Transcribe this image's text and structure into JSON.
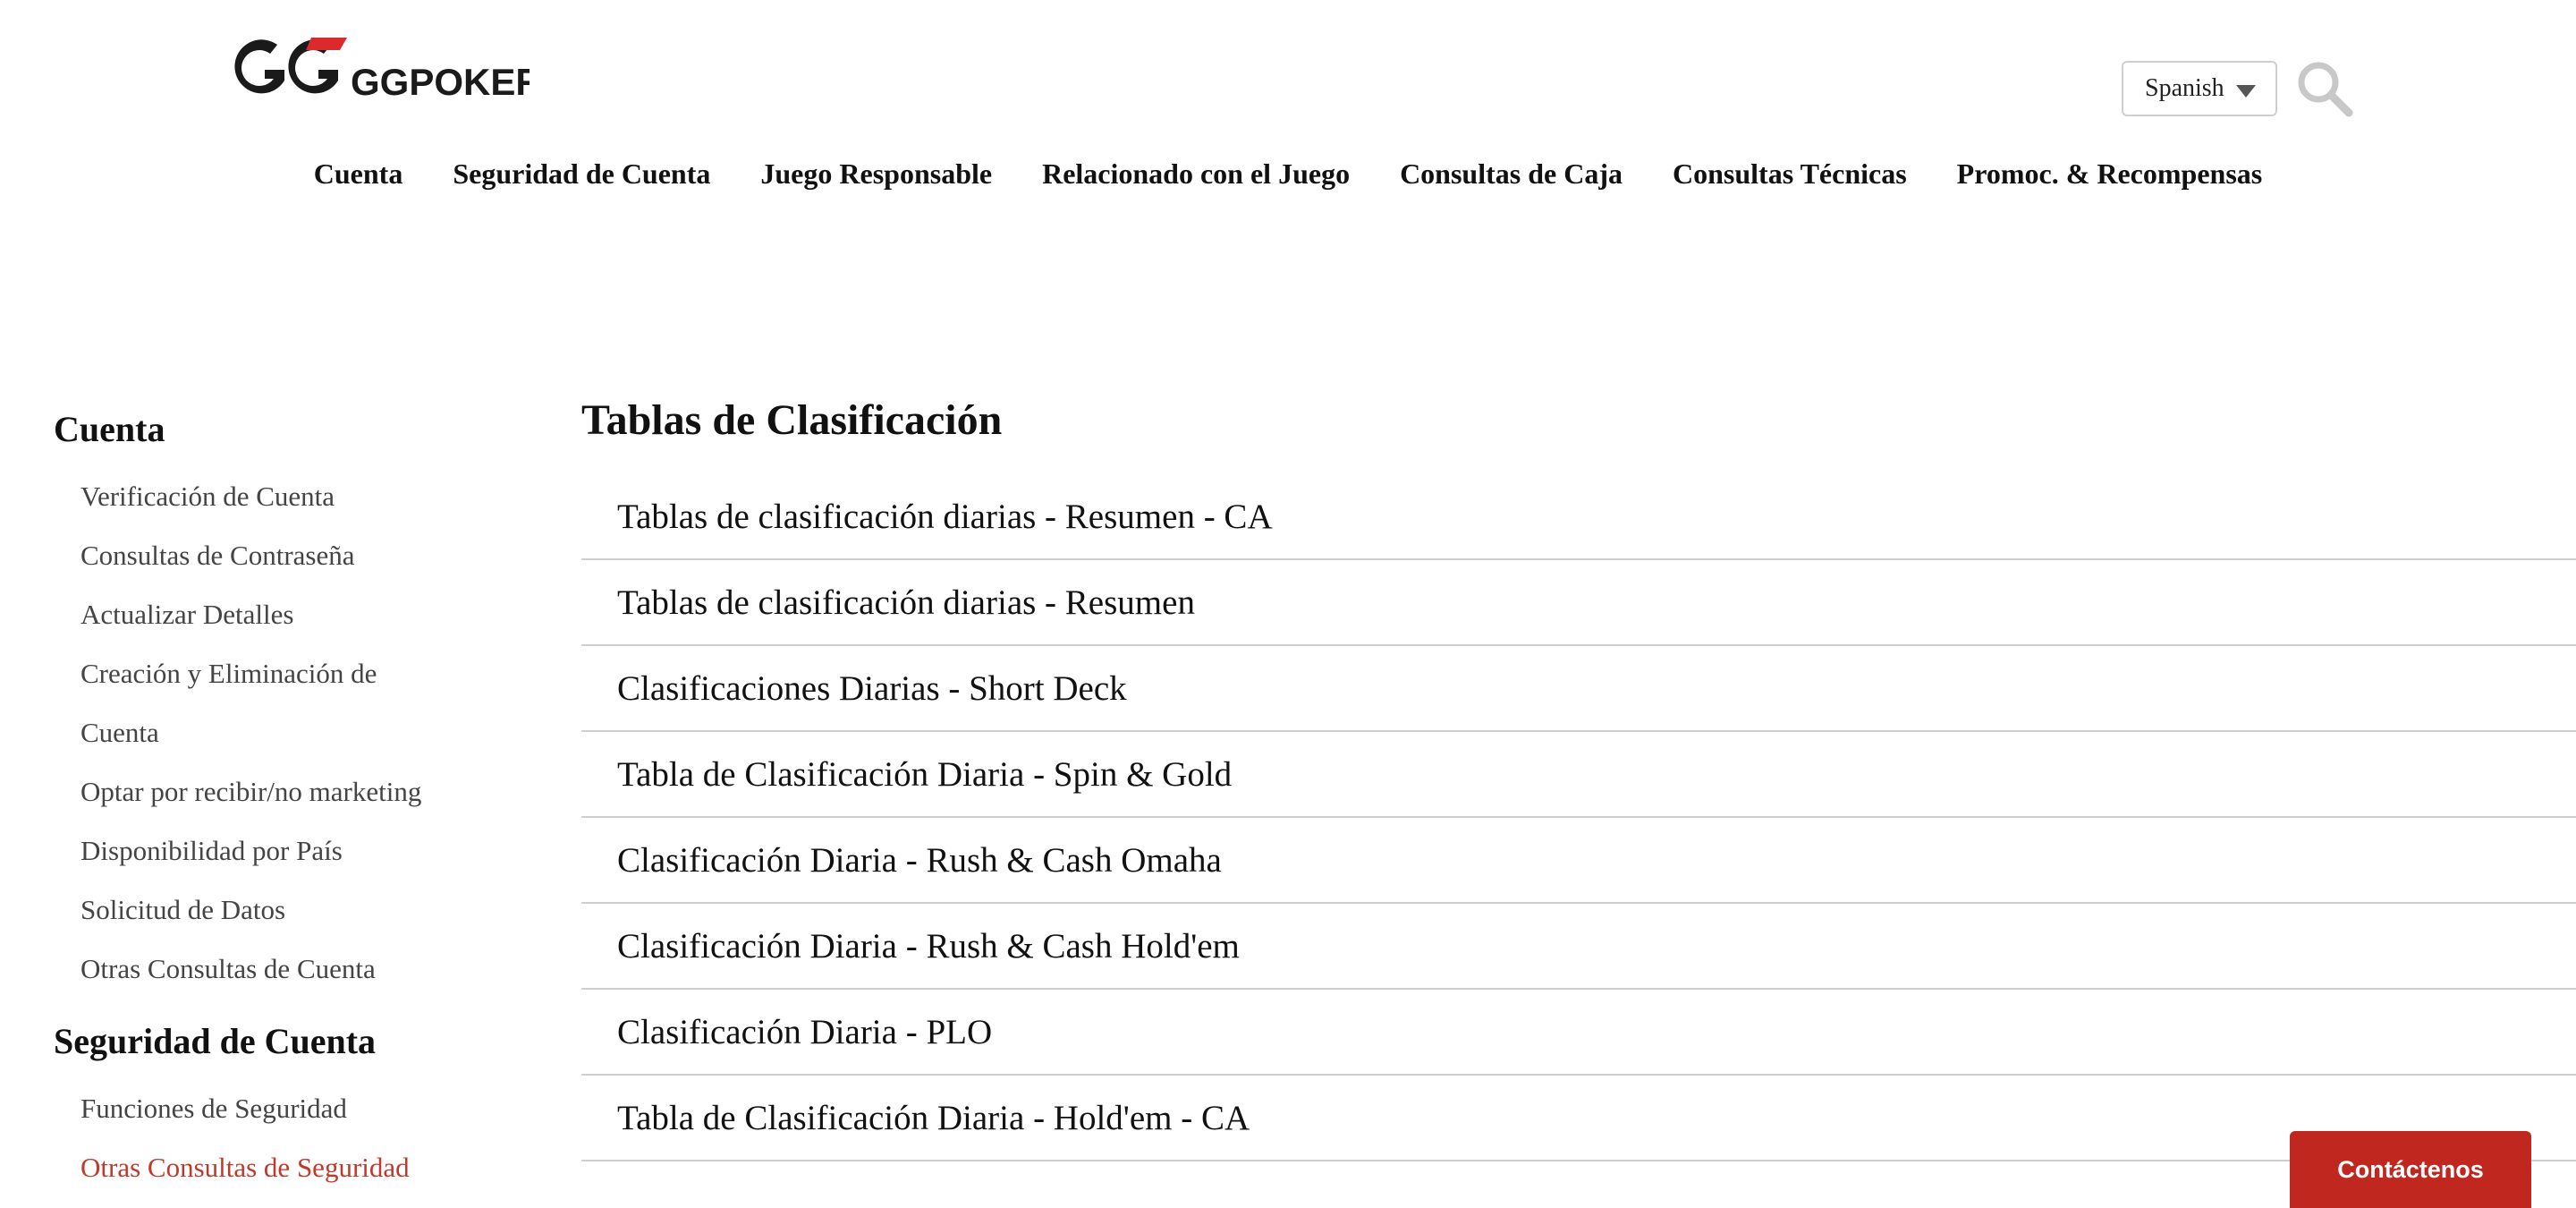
{
  "header": {
    "logo_alt": "GGPOKER",
    "language": {
      "selected": "Spanish"
    },
    "nav": [
      "Cuenta",
      "Seguridad de Cuenta",
      "Juego Responsable",
      "Relacionado con el Juego",
      "Consultas de Caja",
      "Consultas Técnicas",
      "Promoc. & Recompensas"
    ]
  },
  "sidebar": {
    "sections": [
      {
        "title": "Cuenta",
        "items": [
          "Verificación de Cuenta",
          "Consultas de Contraseña",
          "Actualizar Detalles",
          "Creación y Eliminación de Cuenta",
          "Optar por recibir/no marketing",
          "Disponibilidad por País",
          "Solicitud de Datos",
          "Otras Consultas de Cuenta"
        ]
      },
      {
        "title": "Seguridad de Cuenta",
        "items": [
          "Funciones de Seguridad",
          "Otras Consultas de Seguridad"
        ]
      }
    ]
  },
  "main": {
    "title": "Tablas de Clasificación",
    "articles": [
      "Tablas de clasificación diarias - Resumen - CA",
      "Tablas de clasificación diarias - Resumen",
      "Clasificaciones Diarias - Short Deck",
      "Tabla de Clasificación Diaria - Spin & Gold",
      "Clasificación Diaria - Rush & Cash Omaha",
      "Clasificación Diaria - Rush & Cash Hold'em",
      "Clasificación Diaria - PLO",
      "Tabla de Clasificación Diaria - Hold'em - CA"
    ]
  },
  "contact_button": "Contáctenos",
  "colors": {
    "accent": "#c0271f",
    "active_link": "#c0392b",
    "divider": "#cfcfcf"
  },
  "icons": {
    "search": "search-icon",
    "dropdown": "chevron-down-icon"
  }
}
